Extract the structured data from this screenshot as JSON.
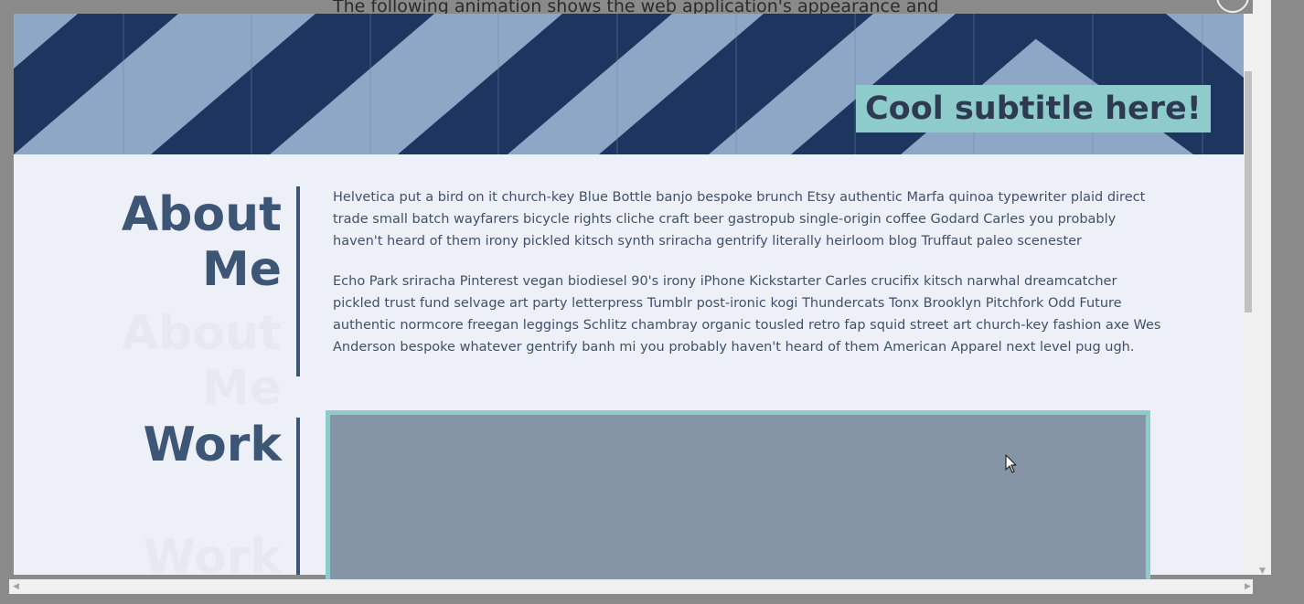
{
  "outer_text": "The following animation shows the web application's appearance and",
  "hero": {
    "subtitle": "Cool subtitle here!"
  },
  "about": {
    "title_line1": "About",
    "title_line2": "Me",
    "paragraph1": "Helvetica put a bird on it church-key Blue Bottle banjo bespoke brunch Etsy authentic Marfa quinoa typewriter plaid direct trade small batch wayfarers bicycle rights cliche craft beer gastropub single-origin coffee Godard Carles you probably haven't heard of them irony pickled kitsch synth sriracha gentrify literally heirloom blog Truffaut paleo scenester",
    "paragraph2": "Echo Park sriracha Pinterest vegan biodiesel 90's irony iPhone Kickstarter Carles crucifix kitsch narwhal dreamcatcher pickled trust fund selvage art party letterpress Tumblr post-ironic kogi Thundercats Tonx Brooklyn Pitchfork Odd Future authentic normcore freegan leggings Schlitz chambray organic tousled retro fap squid street art church-key fashion axe Wes Anderson bespoke whatever gentrify banh mi you probably haven't heard of them American Apparel next level pug ugh."
  },
  "work": {
    "title": "Work"
  },
  "colors": {
    "accent": "#8ecccc",
    "heading": "#3e5676",
    "page_bg": "#eef0f7",
    "hero_light": "#8ea7c6",
    "hero_dark": "#1e3560"
  },
  "icons": {
    "close": "close-icon",
    "scroll_up": "scroll-up-arrow-icon",
    "scroll_down": "scroll-down-arrow-icon",
    "scroll_left": "scroll-left-arrow-icon",
    "scroll_right": "scroll-right-arrow-icon",
    "cursor": "mouse-cursor-icon"
  }
}
